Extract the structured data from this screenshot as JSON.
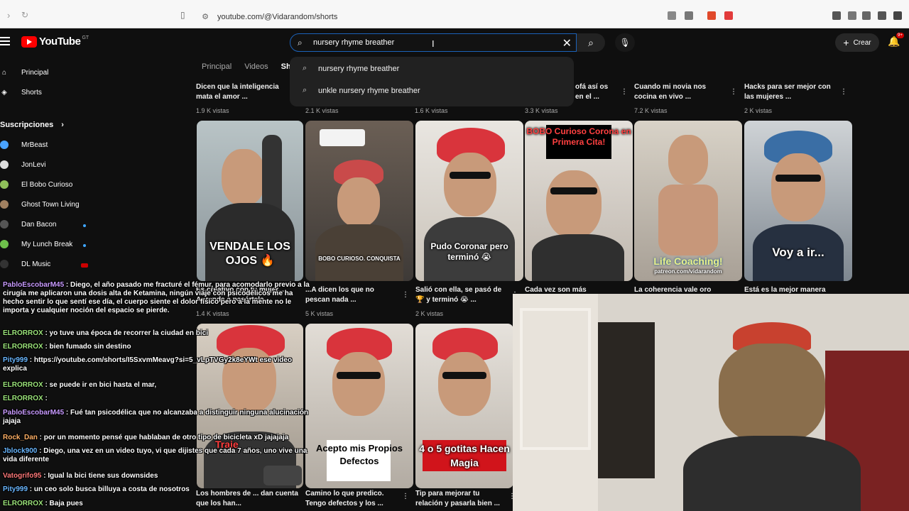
{
  "browser": {
    "url": "youtube.com/@Vidarandom/shorts"
  },
  "header": {
    "logo_text": "YouTube",
    "logo_suffix": "GT",
    "search_value": "nursery rhyme breather",
    "create_label": "Crear",
    "notif_count": "9+"
  },
  "suggestions": [
    "nursery rhyme breather",
    "unkle nursery rhyme breather"
  ],
  "sidebar": {
    "items": [
      {
        "label": "Principal",
        "icon": "home-icon"
      },
      {
        "label": "Shorts",
        "icon": "shorts-icon"
      }
    ],
    "subs_title": "Suscripciones",
    "subs": [
      {
        "label": "MrBeast",
        "color": "#4aa3ff"
      },
      {
        "label": "JonLevi",
        "color": "#dddddd"
      },
      {
        "label": "El Bobo Curioso",
        "color": "#8fbf5a"
      },
      {
        "label": "Ghost Town Living",
        "color": "#a08060"
      },
      {
        "label": "Dan Bacon",
        "color": "#555555",
        "dot": true
      },
      {
        "label": "My Lunch Break",
        "color": "#6ec04b",
        "dot": true
      },
      {
        "label": "DL Music",
        "color": "#333333",
        "live": true
      }
    ]
  },
  "channel_tabs": [
    "Principal",
    "Videos",
    "Sh"
  ],
  "row1": [
    {
      "title": "Dicen que la inteligencia mata el amor ...",
      "views": "1.9 K vistas"
    },
    {
      "title": "",
      "views": "2.1 K vistas"
    },
    {
      "title": "",
      "views": "1.6 K vistas"
    },
    {
      "title": "ofá así os en el ...",
      "views": "3.3 K vistas"
    },
    {
      "title": "Cuando mi novia nos cocina en vivo ...",
      "views": "7.2 K vistas"
    },
    {
      "title": "Hacks para ser mejor con las mujeres ...",
      "views": "2 K vistas"
    }
  ],
  "row2_captions": {
    "t1": "VENDALE LOS OJOS 🔥",
    "t2": "BOBO CURIOSO. CONQUISTA",
    "t3": "Pudo Coronar pero terminó 😭",
    "t4": "BOBO Curioso Corona en Primera Cita!",
    "t5": "Life Coaching!",
    "t5_small": "patreon.com/vidarandom",
    "t6": "Voy a ir..."
  },
  "row2_titles": [
    {
      "title": "Es creativo con tu mujer... Aprende a pasártela ...",
      "views": "1.4 K vistas"
    },
    {
      "title": "...A dicen los que no pescan nada ...",
      "views": "5 K vistas"
    },
    {
      "title": "Salió con ella, se pasó de 🏆 y terminó 😭 ...",
      "views": "2 K vistas"
    },
    {
      "title": "Cada vez son más",
      "views": ""
    },
    {
      "title": "La coherencia vale oro",
      "views": ""
    },
    {
      "title": "Está es la mejor manera",
      "views": ""
    }
  ],
  "row3_captions": {
    "t1": "Traje",
    "t2": "Acepto mis Propios Defectos",
    "t3": "4 o 5 gotitas Hacen Magia"
  },
  "row3_titles": [
    {
      "title": "Los hombres de ... dan cuenta que los han..."
    },
    {
      "title": "Camino lo que predico. Tengo defectos y los ..."
    },
    {
      "title": "Tip para mejorar tu relación y pasarla bien ..."
    }
  ],
  "chat": [
    {
      "user": "PabloEscobarM45",
      "cls": "user purple",
      "text": " : Diego, el año pasado me fracturé el fémur, para acomodarlo previo a la cirugía me aplicaron una dosis alta de Ketamina, ningún viaje con psicodélicos me ha hecho sentir lo que sentí ese día, el cuerpo siente el dolor físico pero a la mente no le importa y cualquier noción del espacio se pierde."
    },
    {
      "user": "ELRORROX",
      "cls": "user green",
      "text": " : yo tuve una época de recorrer la ciudad en bici"
    },
    {
      "user": "ELRORROX",
      "cls": "user green",
      "text": " : bien fumado sin destino"
    },
    {
      "user": "Pity999",
      "cls": "user",
      "text": " : https://youtube.com/shorts/I5SxvmMeavg?si=5_vLpTVGy2k8eYWt ese video explica"
    },
    {
      "user": "ELRORROX",
      "cls": "user green",
      "text": " : se puede ir en bici hasta el mar,"
    },
    {
      "user": "ELRORROX",
      "cls": "user green",
      "text": " : "
    },
    {
      "user": "PabloEscobarM45",
      "cls": "user purple",
      "text": " : Fué tan psicodélica que no alcanzaba a distinguir ninguna alucinación jajaja"
    },
    {
      "user": "Rock_Dan",
      "cls": "user orange",
      "text": " : por un momento pensé que hablaban de otro tipo de bicicleta xD jajajaja"
    },
    {
      "user": "Jblock900",
      "cls": "user",
      "text": " : Diego, una vez en un video tuyo, vi que dijistes que cada 7 años, uno vive una vida diferente"
    },
    {
      "user": "Vatogrifo95",
      "cls": "user red",
      "text": " : Igual la bici tiene sus downsides"
    },
    {
      "user": "Pity999",
      "cls": "user",
      "text": " : un ceo solo busca billuya a costa de nosotros"
    },
    {
      "user": "ELRORROX",
      "cls": "user green",
      "text": " : Baja pues"
    }
  ]
}
